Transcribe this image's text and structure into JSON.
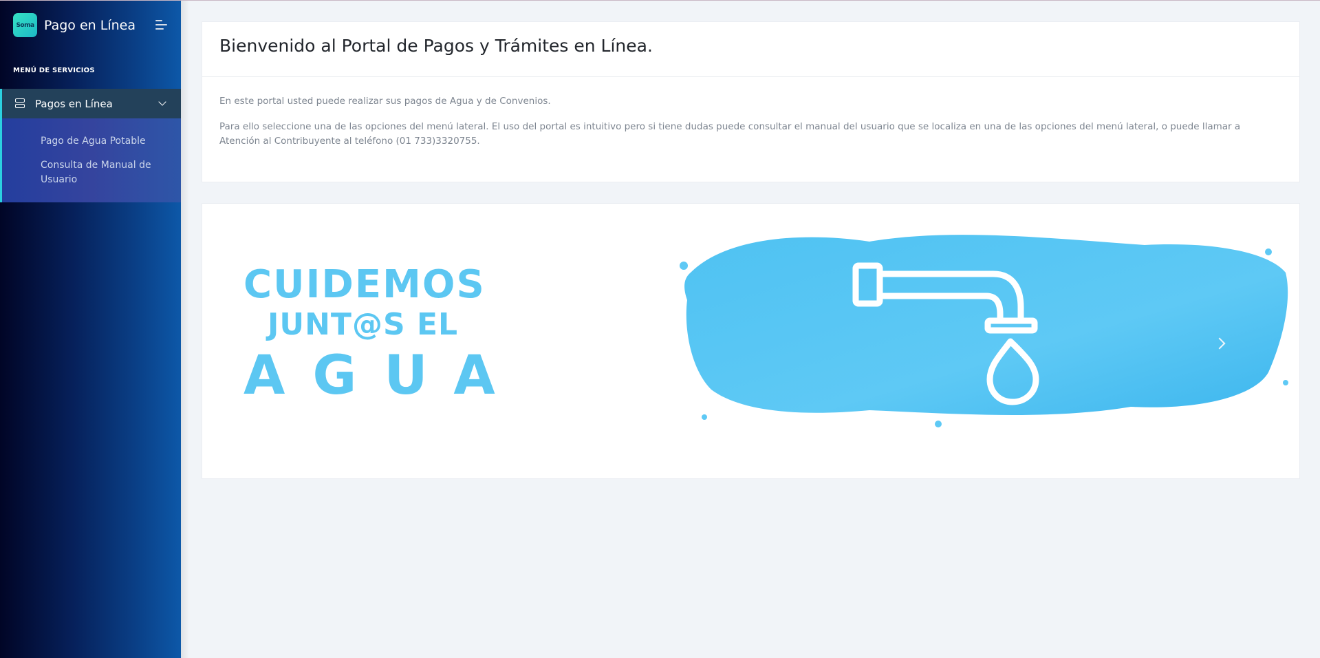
{
  "app": {
    "logo_text": "Soma",
    "title": "Pago en Línea"
  },
  "sidebar": {
    "heading": "MENÚ DE SERVICIOS",
    "parent_item": {
      "label": "Pagos en Línea",
      "icon": "server-icon",
      "expanded": true
    },
    "sub_items": [
      {
        "label": "Pago de Agua Potable"
      },
      {
        "label": "Consulta de Manual de Usuario"
      }
    ]
  },
  "welcome": {
    "title": "Bienvenido al Portal de Pagos y Trámites en Línea.",
    "paragraph1": "En este portal usted puede realizar sus pagos de Agua y de Convenios.",
    "paragraph2": "Para ello seleccione una de las opciones del menú lateral. El uso del portal es intuitivo pero si tiene dudas puede consultar el manual del usuario que se localiza en una de las opciones del menú lateral, o puede llamar a Atención al Contribuyente al teléfono (01 733)3320755."
  },
  "banner": {
    "line1": "CUIDEMOS",
    "line2": "JUNT@S EL",
    "line3": "AGUA",
    "accent_color": "#5cc7f2"
  },
  "colors": {
    "sidebar_accent": "#2bd0e0",
    "page_bg": "#f1f4f8"
  }
}
